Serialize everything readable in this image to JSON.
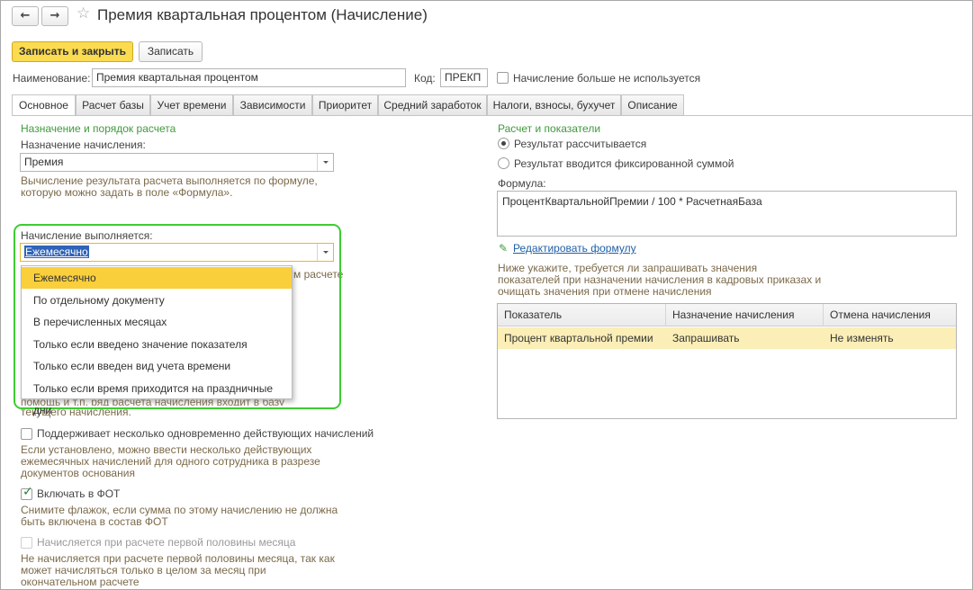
{
  "window": {
    "title": "Премия квартальная процентом (Начисление)",
    "back_icon": "←",
    "forward_icon": "→",
    "star_icon": "☆"
  },
  "toolbar": {
    "save_close_label": "Записать и закрыть",
    "save_label": "Записать"
  },
  "header": {
    "name_label": "Наименование:",
    "name_value": "Премия квартальная процентом",
    "code_label": "Код:",
    "code_value": "ПРЕКП",
    "not_used_label": "Начисление больше не используется"
  },
  "tabs": [
    {
      "label": "Основное"
    },
    {
      "label": "Расчет базы"
    },
    {
      "label": "Учет времени"
    },
    {
      "label": "Зависимости"
    },
    {
      "label": "Приоритет"
    },
    {
      "label": "Средний заработок"
    },
    {
      "label": "Налоги, взносы, бухучет"
    },
    {
      "label": "Описание"
    }
  ],
  "left": {
    "section_title": "Назначение и порядок расчета",
    "purpose_label": "Назначение начисления:",
    "purpose_value": "Премия",
    "purpose_hint": "Вычисление результата расчета выполняется по формуле,\nкоторую можно задать в поле «Формула».",
    "accrual_label": "Начисление выполняется:",
    "accrual_value": "Ежемесячно",
    "partial_hint_right": "м расчете",
    "partial_hint_fragment": "помощь и т.п. ряд расчета начисления входит в базу",
    "partial_hint_tail": "текущего начисления.",
    "multiple_label": "Поддерживает несколько одновременно действующих начислений",
    "multiple_hint": "Если установлено, можно ввести несколько действующих\nежемесячных начислений для одного сотрудника в разрезе\nдокументов основания",
    "fot_label": "Включать в ФОТ",
    "fot_hint": "Снимите флажок, если сумма по этому начислению не должна\nбыть включена в состав ФОТ",
    "first_half_label": "Начисляется при расчете первой половины месяца",
    "first_half_hint": "Не начисляется при расчете первой половины месяца, так как\nможет начисляться только в целом за месяц при\nокончательном расчете"
  },
  "dropdown": {
    "options": [
      "Ежемесячно",
      "По отдельному документу",
      "В перечисленных месяцах",
      "Только если введено значение показателя",
      "Только если введен вид учета времени",
      "Только если время приходится на праздничные дни"
    ],
    "selected_index": 0
  },
  "right": {
    "section_title": "Расчет и показатели",
    "radio_calculated": "Результат рассчитывается",
    "radio_fixed": "Результат вводится фиксированной суммой",
    "formula_label": "Формула:",
    "formula_value": "ПроцентКвартальнойПремии / 100 * РасчетнаяБаза",
    "edit_formula_link": "Редактировать формулу",
    "pencil_icon": "✎",
    "indicators_hint": "Ниже укажите, требуется ли запрашивать значения\nпоказателей при назначении начисления в кадровых приказах и\nочищать значения при отмене начисления",
    "table": {
      "headers": [
        "Показатель",
        "Назначение начисления",
        "Отмена начисления"
      ],
      "rows": [
        [
          "Процент квартальной премии",
          "Запрашивать",
          "Не изменять"
        ]
      ]
    }
  },
  "colors": {
    "accent_yellow": "#fbdb4f",
    "section_green": "#3f9a3c",
    "highlight_green": "#3dcc32",
    "hint_brown": "#7b6a4a",
    "link_blue": "#1f5fa7",
    "row_highlight": "#fbeeb6",
    "dropdown_selected": "#f9cf3c"
  }
}
